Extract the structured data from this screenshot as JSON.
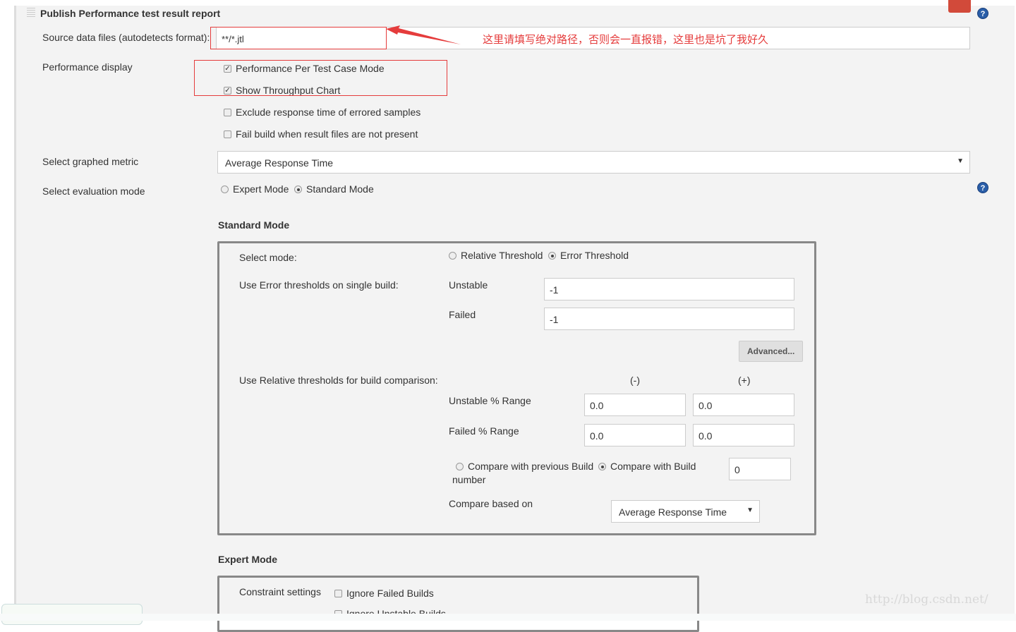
{
  "section_title": "Publish Performance test result report",
  "source": {
    "label": "Source data files (autodetects format):",
    "value": "**/*.jtl"
  },
  "annotation": "这里请填写绝对路径，否则会一直报错，这里也是坑了我好久",
  "perf_display": {
    "label": "Performance display",
    "options": [
      {
        "label": "Performance Per Test Case Mode",
        "checked": true
      },
      {
        "label": "Show Throughput Chart",
        "checked": true
      },
      {
        "label": "Exclude response time of errored samples",
        "checked": false
      },
      {
        "label": "Fail build when result files are not present",
        "checked": false
      }
    ]
  },
  "graphed_metric": {
    "label": "Select graphed metric",
    "value": "Average Response Time"
  },
  "eval_mode": {
    "label": "Select evaluation mode",
    "expert": "Expert Mode",
    "standard": "Standard Mode",
    "selected": "Standard Mode"
  },
  "standard": {
    "heading": "Standard Mode",
    "select_mode": {
      "label": "Select mode:",
      "relative": "Relative Threshold",
      "error": "Error Threshold",
      "selected": "Error Threshold"
    },
    "error_thresholds": {
      "label": "Use Error thresholds on single build:",
      "unstable_label": "Unstable",
      "unstable": "-1",
      "failed_label": "Failed",
      "failed": "-1"
    },
    "advanced": "Advanced...",
    "relative": {
      "label": "Use Relative thresholds for build comparison:",
      "minus": "(-)",
      "plus": "(+)",
      "unstable_label": "Unstable % Range",
      "unstable_minus": "0.0",
      "unstable_plus": "0.0",
      "failed_label": "Failed % Range",
      "failed_minus": "0.0",
      "failed_plus": "0.0"
    },
    "compare": {
      "previous": "Compare with previous Build",
      "build": "Compare with Build",
      "number": "number",
      "build_value": "0",
      "selected": "Compare with Build"
    },
    "based_on": {
      "label": "Compare based on",
      "value": "Average Response Time"
    }
  },
  "expert": {
    "heading": "Expert Mode",
    "constraint_label": "Constraint settings",
    "ignore_failed": "Ignore Failed Builds",
    "ignore_unstable": "Ignore Unstable Builds"
  },
  "watermark": "http://blog.csdn.net/",
  "colors": {
    "annotation": "#e53c3c",
    "help": "#2a5ea8"
  }
}
